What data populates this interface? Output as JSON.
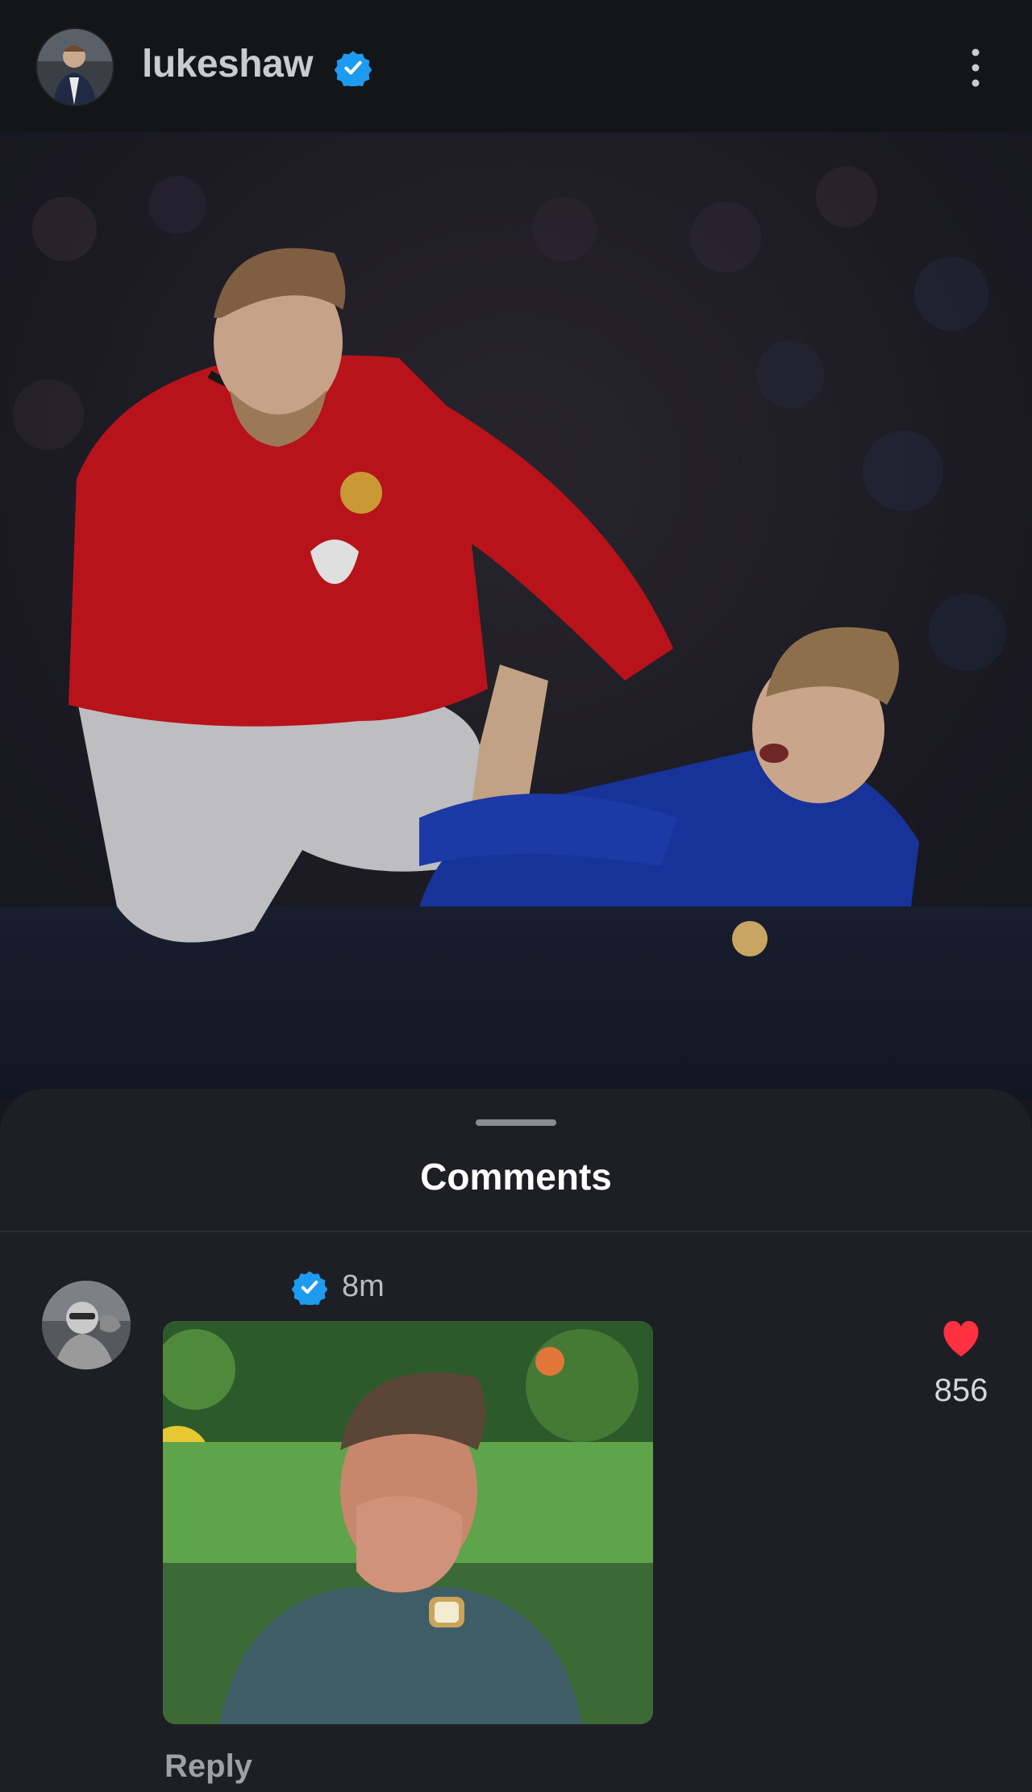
{
  "header": {
    "username": "lukeshaw",
    "verified_icon": "verified-badge-icon",
    "menu_icon": "more-vertical-icon"
  },
  "post": {
    "image_icon": "football-photo"
  },
  "comments_sheet": {
    "title": "Comments",
    "comment": {
      "username": "",
      "time": "8m",
      "gif_icon": "laughing-man-gif",
      "reply_label": "Reply",
      "like_count": "856",
      "like_color": "#ff3040"
    }
  },
  "colors": {
    "verified_blue": "#1d9bf0",
    "like_red": "#ff3040",
    "background": "#17181c",
    "sheet": "#1e1f24"
  }
}
